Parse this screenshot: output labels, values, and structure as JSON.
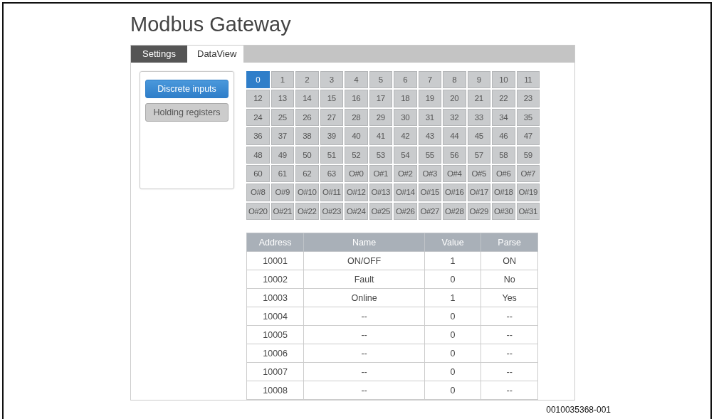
{
  "title": "Modbus Gateway",
  "tabs": [
    {
      "label": "Settings",
      "selected": false
    },
    {
      "label": "DataView",
      "selected": true
    }
  ],
  "register_types": [
    {
      "label": "Discrete inputs",
      "selected": true
    },
    {
      "label": "Holding registers",
      "selected": false
    }
  ],
  "channels": [
    {
      "label": "0",
      "selected": true
    },
    {
      "label": "1",
      "selected": false
    },
    {
      "label": "2",
      "selected": false
    },
    {
      "label": "3",
      "selected": false
    },
    {
      "label": "4",
      "selected": false
    },
    {
      "label": "5",
      "selected": false
    },
    {
      "label": "6",
      "selected": false
    },
    {
      "label": "7",
      "selected": false
    },
    {
      "label": "8",
      "selected": false
    },
    {
      "label": "9",
      "selected": false
    },
    {
      "label": "10",
      "selected": false
    },
    {
      "label": "11",
      "selected": false
    },
    {
      "label": "12",
      "selected": false
    },
    {
      "label": "13",
      "selected": false
    },
    {
      "label": "14",
      "selected": false
    },
    {
      "label": "15",
      "selected": false
    },
    {
      "label": "16",
      "selected": false
    },
    {
      "label": "17",
      "selected": false
    },
    {
      "label": "18",
      "selected": false
    },
    {
      "label": "19",
      "selected": false
    },
    {
      "label": "20",
      "selected": false
    },
    {
      "label": "21",
      "selected": false
    },
    {
      "label": "22",
      "selected": false
    },
    {
      "label": "23",
      "selected": false
    },
    {
      "label": "24",
      "selected": false
    },
    {
      "label": "25",
      "selected": false
    },
    {
      "label": "26",
      "selected": false
    },
    {
      "label": "27",
      "selected": false
    },
    {
      "label": "28",
      "selected": false
    },
    {
      "label": "29",
      "selected": false
    },
    {
      "label": "30",
      "selected": false
    },
    {
      "label": "31",
      "selected": false
    },
    {
      "label": "32",
      "selected": false
    },
    {
      "label": "33",
      "selected": false
    },
    {
      "label": "34",
      "selected": false
    },
    {
      "label": "35",
      "selected": false
    },
    {
      "label": "36",
      "selected": false
    },
    {
      "label": "37",
      "selected": false
    },
    {
      "label": "38",
      "selected": false
    },
    {
      "label": "39",
      "selected": false
    },
    {
      "label": "40",
      "selected": false
    },
    {
      "label": "41",
      "selected": false
    },
    {
      "label": "42",
      "selected": false
    },
    {
      "label": "43",
      "selected": false
    },
    {
      "label": "44",
      "selected": false
    },
    {
      "label": "45",
      "selected": false
    },
    {
      "label": "46",
      "selected": false
    },
    {
      "label": "47",
      "selected": false
    },
    {
      "label": "48",
      "selected": false
    },
    {
      "label": "49",
      "selected": false
    },
    {
      "label": "50",
      "selected": false
    },
    {
      "label": "51",
      "selected": false
    },
    {
      "label": "52",
      "selected": false
    },
    {
      "label": "53",
      "selected": false
    },
    {
      "label": "54",
      "selected": false
    },
    {
      "label": "55",
      "selected": false
    },
    {
      "label": "56",
      "selected": false
    },
    {
      "label": "57",
      "selected": false
    },
    {
      "label": "58",
      "selected": false
    },
    {
      "label": "59",
      "selected": false
    },
    {
      "label": "60",
      "selected": false
    },
    {
      "label": "61",
      "selected": false
    },
    {
      "label": "62",
      "selected": false
    },
    {
      "label": "63",
      "selected": false
    },
    {
      "label": "O#0",
      "selected": false
    },
    {
      "label": "O#1",
      "selected": false
    },
    {
      "label": "O#2",
      "selected": false
    },
    {
      "label": "O#3",
      "selected": false
    },
    {
      "label": "O#4",
      "selected": false
    },
    {
      "label": "O#5",
      "selected": false
    },
    {
      "label": "O#6",
      "selected": false
    },
    {
      "label": "O#7",
      "selected": false
    },
    {
      "label": "O#8",
      "selected": false
    },
    {
      "label": "O#9",
      "selected": false
    },
    {
      "label": "O#10",
      "selected": false
    },
    {
      "label": "O#11",
      "selected": false
    },
    {
      "label": "O#12",
      "selected": false
    },
    {
      "label": "O#13",
      "selected": false
    },
    {
      "label": "O#14",
      "selected": false
    },
    {
      "label": "O#15",
      "selected": false
    },
    {
      "label": "O#16",
      "selected": false
    },
    {
      "label": "O#17",
      "selected": false
    },
    {
      "label": "O#18",
      "selected": false
    },
    {
      "label": "O#19",
      "selected": false
    },
    {
      "label": "O#20",
      "selected": false
    },
    {
      "label": "O#21",
      "selected": false
    },
    {
      "label": "O#22",
      "selected": false
    },
    {
      "label": "O#23",
      "selected": false
    },
    {
      "label": "O#24",
      "selected": false
    },
    {
      "label": "O#25",
      "selected": false
    },
    {
      "label": "O#26",
      "selected": false
    },
    {
      "label": "O#27",
      "selected": false
    },
    {
      "label": "O#28",
      "selected": false
    },
    {
      "label": "O#29",
      "selected": false
    },
    {
      "label": "O#30",
      "selected": false
    },
    {
      "label": "O#31",
      "selected": false
    }
  ],
  "table": {
    "columns": [
      "Address",
      "Name",
      "Value",
      "Parse"
    ],
    "rows": [
      [
        "10001",
        "ON/OFF",
        "1",
        "ON"
      ],
      [
        "10002",
        "Fault",
        "0",
        "No"
      ],
      [
        "10003",
        "Online",
        "1",
        "Yes"
      ],
      [
        "10004",
        "--",
        "0",
        "--"
      ],
      [
        "10005",
        "--",
        "0",
        "--"
      ],
      [
        "10006",
        "--",
        "0",
        "--"
      ],
      [
        "10007",
        "--",
        "0",
        "--"
      ],
      [
        "10008",
        "--",
        "0",
        "--"
      ]
    ]
  },
  "figure_id": "0010035368-001"
}
